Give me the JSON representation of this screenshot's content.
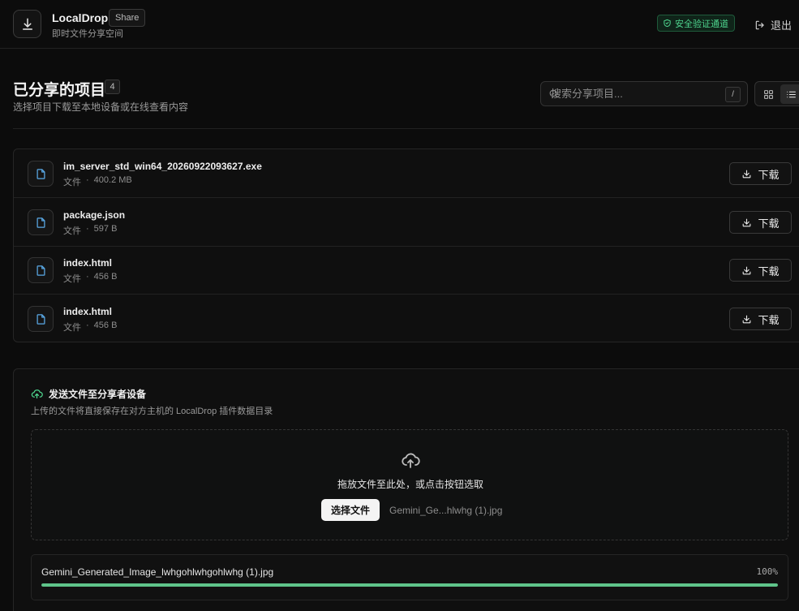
{
  "header": {
    "app_name": "LocalDrop",
    "share_label": "Share",
    "subtitle": "即时文件分享空间",
    "secure_label": "安全验证通道",
    "logout_label": "退出"
  },
  "section": {
    "title": "已分享的项目",
    "count": "4",
    "subtitle": "选择项目下载至本地设备或在线查看内容"
  },
  "search": {
    "placeholder": "搜索分享项目...",
    "value": "",
    "shortcut": "/"
  },
  "view": {
    "active": "list"
  },
  "files": [
    {
      "name": "im_server_std_win64_20260922093627.exe",
      "type": "文件",
      "sep": "·",
      "size": "400.2 MB",
      "action": "下载"
    },
    {
      "name": "package.json",
      "type": "文件",
      "sep": "·",
      "size": "597 B",
      "action": "下载"
    },
    {
      "name": "index.html",
      "type": "文件",
      "sep": "·",
      "size": "456 B",
      "action": "下载"
    },
    {
      "name": "index.html",
      "type": "文件",
      "sep": "·",
      "size": "456 B",
      "action": "下载"
    }
  ],
  "upload": {
    "title": "发送文件至分享者设备",
    "subtitle": "上传的文件将直接保存在对方主机的 LocalDrop 插件数据目录",
    "drop_text": "拖放文件至此处，或点击按钮选取",
    "choose_label": "选择文件",
    "chosen_name": "Gemini_Ge...hlwhg (1).jpg",
    "progress": {
      "file_name": "Gemini_Generated_Image_lwhgohlwhgohlwhg (1).jpg",
      "percent_label": "100%",
      "fraction": 1.0
    }
  },
  "colors": {
    "accent_green": "#4ed38d",
    "progress_green": "#5fc48a",
    "file_icon_blue": "#5aa9e6"
  },
  "icons": {
    "logo": "download-icon",
    "secure": "shield-check-icon",
    "logout": "logout-icon",
    "search": "search-icon",
    "grid": "grid-icon",
    "list": "list-icon",
    "file": "file-icon",
    "download": "download-icon",
    "upload": "cloud-upload-icon"
  }
}
